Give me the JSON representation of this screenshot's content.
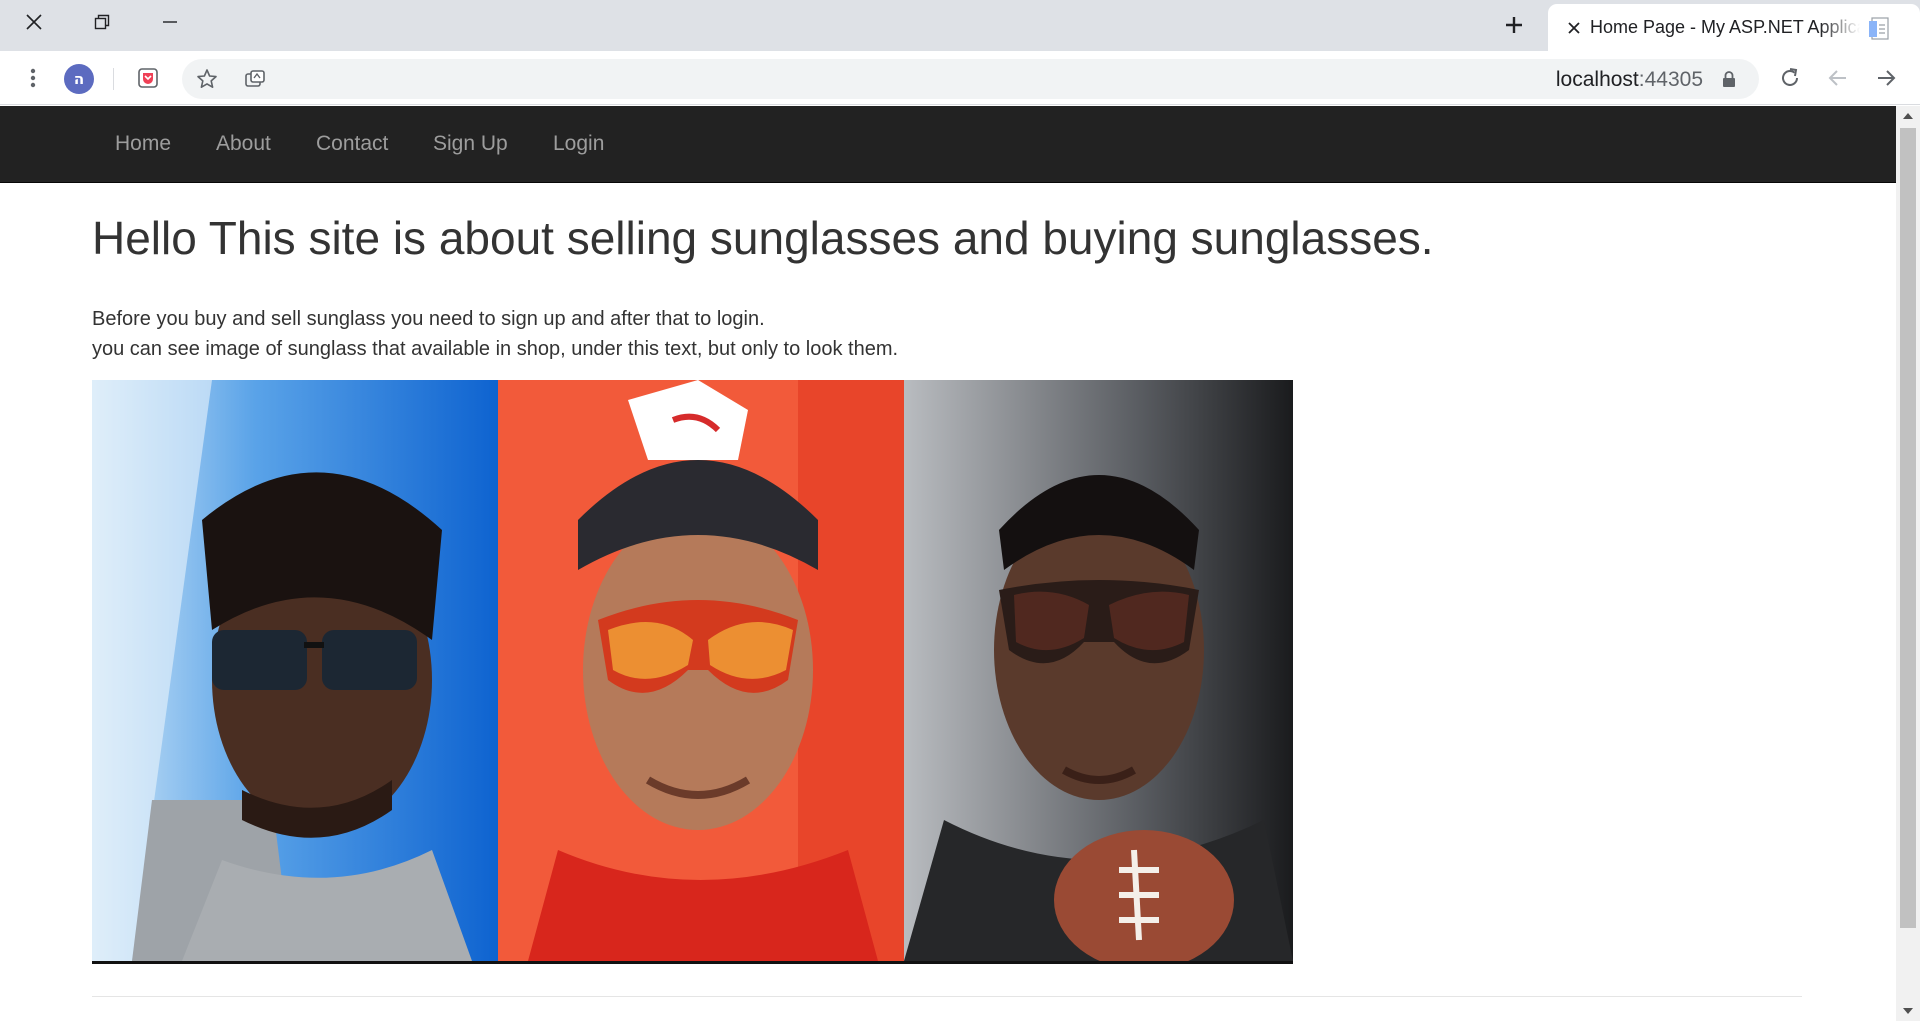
{
  "browser": {
    "tab": {
      "title": "Home Page - My ASP.NET Application"
    },
    "address": {
      "host": "localhost",
      "port": ":44305"
    },
    "profile": {
      "initial": "ה"
    }
  },
  "icons": {
    "close": "close-icon",
    "restore": "restore-icon",
    "minimize": "minimize-icon",
    "new_tab": "plus-icon",
    "menu": "kebab-menu-icon",
    "bookmark": "star-icon",
    "reload": "reload-icon",
    "back": "back-arrow-icon",
    "forward": "forward-arrow-icon",
    "lock": "lock-icon"
  },
  "navbar": {
    "items": [
      {
        "label": "Home"
      },
      {
        "label": "About"
      },
      {
        "label": "Contact"
      },
      {
        "label": "Sign Up"
      },
      {
        "label": "Login"
      }
    ]
  },
  "main": {
    "heading": "Hello This site is about selling sunglasses and buying sunglasses.",
    "lines": [
      "Before you buy and sell sunglass you need to sign up and after that to login.",
      "you can see image of sunglass that available in shop, under this text, but only to look them."
    ]
  },
  "colors": {
    "navbar_bg": "#222222",
    "nav_text": "#9d9d9d",
    "chrome_bg": "#dee1e6"
  }
}
